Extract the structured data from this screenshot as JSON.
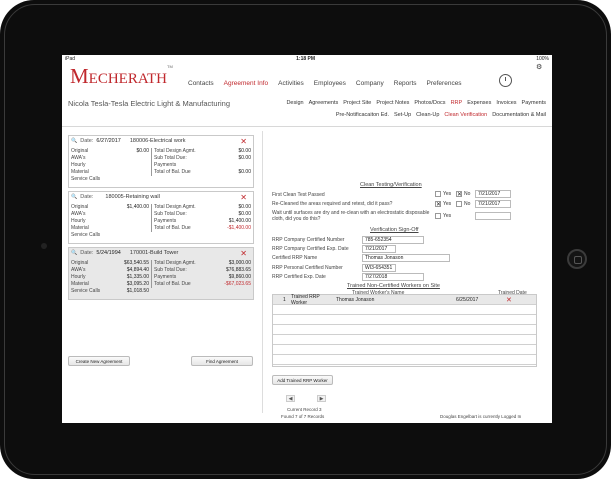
{
  "status_bar": {
    "carrier": "iPad",
    "time": "1:18 PM",
    "battery": "100%"
  },
  "brand": {
    "logo": "Mecherath",
    "tm": "TM"
  },
  "main_nav": [
    {
      "label": "Contacts",
      "active": false
    },
    {
      "label": "Agreement Info",
      "active": true
    },
    {
      "label": "Activities",
      "active": false
    },
    {
      "label": "Employees",
      "active": false
    },
    {
      "label": "Company",
      "active": false
    },
    {
      "label": "Reports",
      "active": false
    },
    {
      "label": "Preferences",
      "active": false
    }
  ],
  "company_name": "Nicola Tesla-Tesla Electric Light & Manufacturing",
  "sub_nav_1": [
    {
      "label": "Design",
      "active": false
    },
    {
      "label": "Agreements",
      "active": false
    },
    {
      "label": "Project Site",
      "active": false
    },
    {
      "label": "Project Notes",
      "active": false
    },
    {
      "label": "Photos/Docs",
      "active": false
    },
    {
      "label": "RRP",
      "active": true
    },
    {
      "label": "Expenses",
      "active": false
    },
    {
      "label": "Invoices",
      "active": false
    },
    {
      "label": "Payments",
      "active": false
    }
  ],
  "sub_nav_2": [
    {
      "label": "Pre-Notificacaiton Ed.",
      "active": false
    },
    {
      "label": "Set-Up",
      "active": false
    },
    {
      "label": "Clean-Up",
      "active": false
    },
    {
      "label": "Clean Verification",
      "active": true
    },
    {
      "label": "Documentation & Mail",
      "active": false
    }
  ],
  "agreements": [
    {
      "date_label": "Date:",
      "date": "6/27/2017",
      "project": "180006-Electrical work",
      "left": [
        {
          "k": "Original",
          "v": "$0.00"
        },
        {
          "k": "AWA's",
          "v": ""
        },
        {
          "k": "Hourly",
          "v": ""
        },
        {
          "k": "Material",
          "v": ""
        },
        {
          "k": "Service Calls",
          "v": ""
        }
      ],
      "right": [
        {
          "k": "Total Design Agmt.",
          "v": "$0.00",
          "neg": false
        },
        {
          "k": "Sub Total Due:",
          "v": "$0.00",
          "neg": false
        },
        {
          "k": "Payments",
          "v": "",
          "neg": false
        },
        {
          "k": "Total of Bal. Due",
          "v": "$0.00",
          "neg": false
        }
      ]
    },
    {
      "date_label": "Date:",
      "date": "",
      "project": "180005-Retaining wall",
      "left": [
        {
          "k": "Original",
          "v": "$1,400.00"
        },
        {
          "k": "AWA's",
          "v": ""
        },
        {
          "k": "Hourly",
          "v": ""
        },
        {
          "k": "Material",
          "v": ""
        },
        {
          "k": "Service Calls",
          "v": ""
        }
      ],
      "right": [
        {
          "k": "Total Design Agmt.",
          "v": "$0.00",
          "neg": false
        },
        {
          "k": "Sub Total Due:",
          "v": "$0.00",
          "neg": false
        },
        {
          "k": "Payments",
          "v": "$1,400.00",
          "neg": false
        },
        {
          "k": "Total of Bal. Due",
          "v": "-$1,400.00",
          "neg": true
        }
      ]
    },
    {
      "date_label": "Date:",
      "date": "5/24/1994",
      "project": "170001-Build Tower",
      "left": [
        {
          "k": "Original",
          "v": "$63,540.55"
        },
        {
          "k": "AWA's",
          "v": "$4,894.40"
        },
        {
          "k": "Hourly",
          "v": "$1,335.00"
        },
        {
          "k": "Material",
          "v": "$3,095.20"
        },
        {
          "k": "Service Calls",
          "v": "$1,018.50"
        }
      ],
      "right": [
        {
          "k": "Total Design Agmt.",
          "v": "$3,000.00",
          "neg": false
        },
        {
          "k": "Sub Total Due:",
          "v": "$76,883.65",
          "neg": false
        },
        {
          "k": "Payments",
          "v": "$9,860.00",
          "neg": false
        },
        {
          "k": "Total of Bal. Due",
          "v": "-$67,023.65",
          "neg": true
        }
      ]
    }
  ],
  "buttons": {
    "create_agreement": "Create New Agreement",
    "find_agreement": "Find Agreement",
    "add_rrp_worker": "Add Trained RRP Worker"
  },
  "clean_testing": {
    "title": "Clean Testing/Verification",
    "q1": "First Clean Test Passed",
    "q1_yes": "Yes",
    "q1_no": "No",
    "q1_no_checked": "✕",
    "q1_date": "7/21/2017",
    "q2": "Re-Cleaned the areas required and retest, did it pass?",
    "q2_yes": "Yes",
    "q2_no": "No",
    "q2_yes_checked": "✕",
    "q2_date": "7/21/2017",
    "q3": "Wait until surfaces are dry and re-clean with an electrostatic disposable cloth, did you do this?",
    "q3_yes": "Yes"
  },
  "verification": {
    "title": "Verification Sign-Off",
    "fields": [
      {
        "label": "RRP Company Certified Number",
        "value": "785-652354"
      },
      {
        "label": "RRP Company Certified Exp. Date",
        "value": "7/21/2017"
      },
      {
        "label": "Certified RRP Name",
        "value": "Thomas Jonason"
      },
      {
        "label": "RRP Personal Certified Number",
        "value": "WI3-654351"
      },
      {
        "label": "RRP Certified Exp. Date",
        "value": "7/27/2018"
      }
    ]
  },
  "trained_workers": {
    "title": "Trained Non-Certified Workers on Site",
    "col_name": "Trained Worker's Name",
    "col_date": "Trained Date",
    "rows": [
      {
        "num": "1",
        "role": "Trained RRP Worker",
        "name": "Thomas Jonason",
        "date": "6/25/2017"
      }
    ]
  },
  "footer": {
    "current_record": "Current Record 3",
    "found": "Found 7 of 7 Records",
    "logged_in": "Douglas Engelbart is currently Logged In",
    "prev": "◀",
    "next": "▶"
  }
}
